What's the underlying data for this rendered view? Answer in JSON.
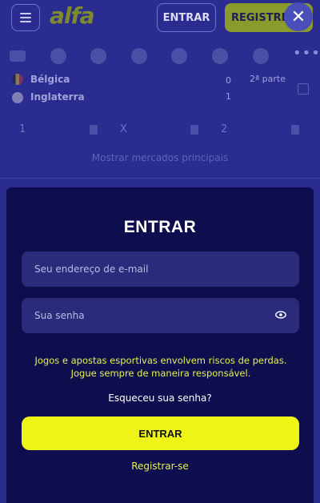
{
  "header": {
    "logo_text": "alfa",
    "login_label": "ENTRAR",
    "register_label": "REGISTRE",
    "close_symbol": "✕"
  },
  "sports_bar": {
    "icons": [
      "live-icon",
      "soccer-icon",
      "basketball-icon",
      "tennis-icon",
      "american-football-icon",
      "volleyball-icon",
      "hockey-icon"
    ],
    "more_symbol": "•••"
  },
  "match": {
    "team_home": "Bélgica",
    "team_away": "Inglaterra",
    "score_home": "0",
    "score_away": "1",
    "period": "2ª parte",
    "odds_labels": [
      "1",
      "X",
      "2"
    ]
  },
  "show_more_label": "Mostrar mercados principais",
  "login_modal": {
    "title": "ENTRAR",
    "email_placeholder": "Seu endereço de e-mail",
    "password_placeholder": "Sua senha",
    "warning_text": "Jogos e apostas esportivas envolvem riscos de perdas. Jogue sempre de maneira responsável.",
    "forgot_password": "Esqueceu sua senha?",
    "submit_label": "ENTRAR",
    "register_link": "Registrar-se"
  },
  "colors": {
    "modal_bg": "#0e0e4e",
    "accent_yellow": "#eef415",
    "field_bg": "#2a2b7a"
  }
}
